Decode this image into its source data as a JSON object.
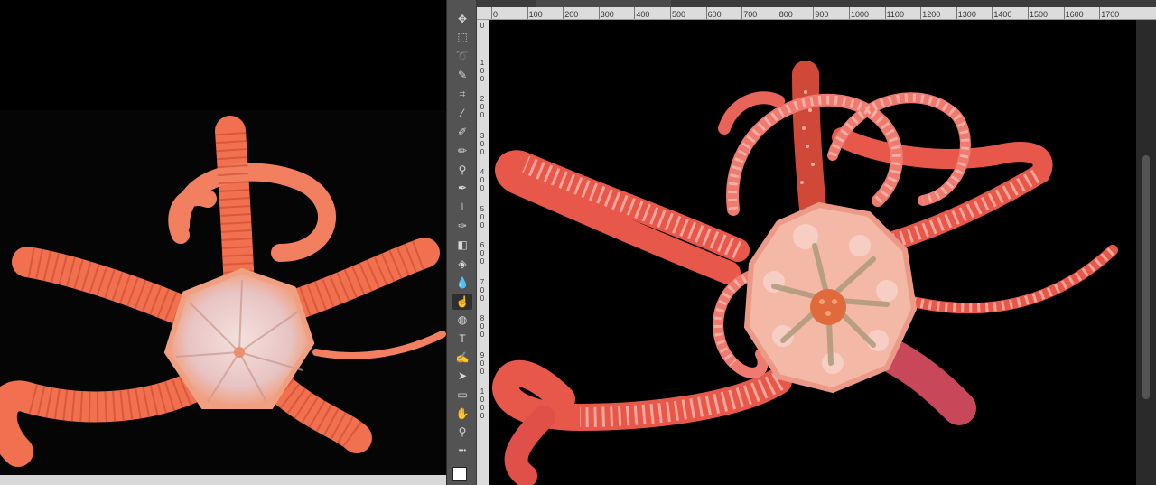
{
  "reference_photo": {
    "alt": "brittle star reference photo"
  },
  "toolbar": {
    "tools": [
      {
        "name": "move-tool-icon",
        "glyph": "✥"
      },
      {
        "name": "marquee-tool-icon",
        "glyph": "⬚"
      },
      {
        "name": "lasso-tool-icon",
        "glyph": "➰"
      },
      {
        "name": "quick-selection-tool-icon",
        "glyph": "✎"
      },
      {
        "name": "crop-tool-icon",
        "glyph": "⌗"
      },
      {
        "name": "eyedropper-tool-icon",
        "glyph": "⁄"
      },
      {
        "name": "healing-brush-tool-icon",
        "glyph": "✐"
      },
      {
        "name": "brush-tool-icon",
        "glyph": "✏"
      },
      {
        "name": "clone-stamp-tool-icon",
        "glyph": "⚲"
      },
      {
        "name": "history-brush-tool-icon",
        "glyph": "✒"
      },
      {
        "name": "stamp-tool-icon",
        "glyph": "⊥"
      },
      {
        "name": "mixer-brush-tool-icon",
        "glyph": "✑"
      },
      {
        "name": "eraser-tool-icon",
        "glyph": "◧"
      },
      {
        "name": "paint-bucket-tool-icon",
        "glyph": "◈"
      },
      {
        "name": "blur-tool-icon",
        "glyph": "💧"
      },
      {
        "name": "smudge-tool-icon",
        "glyph": "☝"
      },
      {
        "name": "sponge-tool-icon",
        "glyph": "◍"
      },
      {
        "name": "type-tool-icon",
        "glyph": "T"
      },
      {
        "name": "pen-tool-icon",
        "glyph": "✍"
      },
      {
        "name": "path-selection-tool-icon",
        "glyph": "➤"
      },
      {
        "name": "rectangle-tool-icon",
        "glyph": "▭"
      },
      {
        "name": "hand-tool-icon",
        "glyph": "✋"
      },
      {
        "name": "zoom-tool-icon",
        "glyph": "⚲"
      },
      {
        "name": "more-tools-icon",
        "glyph": "•••"
      }
    ],
    "active_tool": "smudge-tool-icon"
  },
  "ruler": {
    "horizontal": [
      "0",
      "100",
      "200",
      "300",
      "400",
      "500",
      "600",
      "700",
      "800",
      "900",
      "1000",
      "1100",
      "1200",
      "1300",
      "1400",
      "1500",
      "1600",
      "1700"
    ],
    "vertical": [
      "0",
      "100",
      "200",
      "300",
      "400",
      "500",
      "600",
      "700",
      "800",
      "900",
      "1000"
    ]
  },
  "colors": {
    "arm": "#e8584a",
    "arm_dark": "#c8302a",
    "disc": "#f4b8a6",
    "disc_light": "#f8d6cc",
    "center": "#e06a3c",
    "photo_arm": "#f07050",
    "photo_disc": "#e8c8c0"
  }
}
